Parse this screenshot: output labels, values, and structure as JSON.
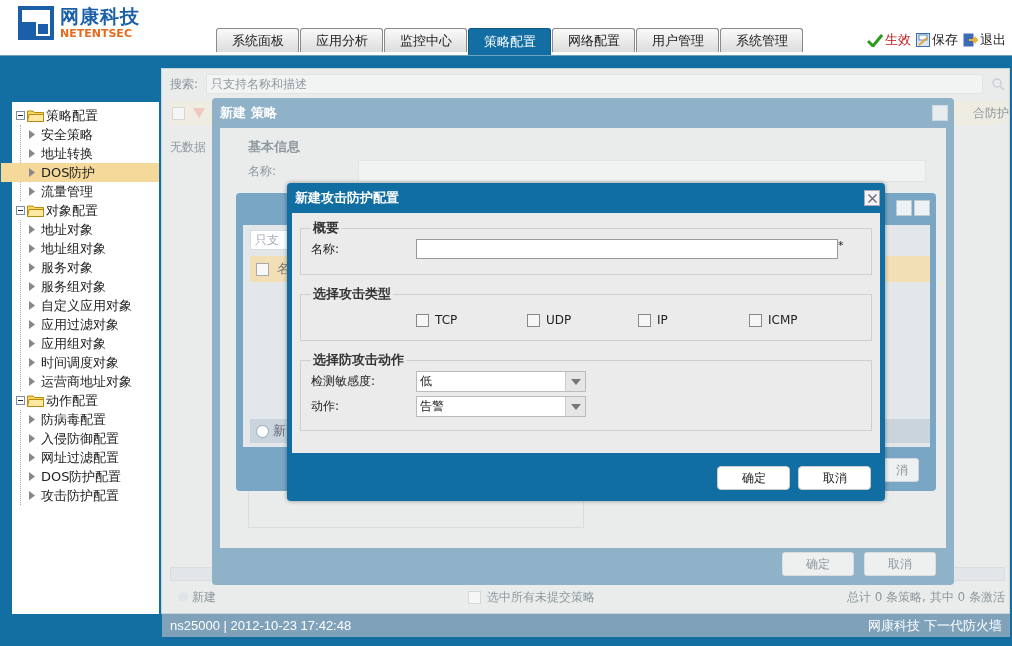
{
  "logo": {
    "name": "网康科技",
    "sub": "NETENTSEC"
  },
  "tabs": [
    {
      "label": "系统面板",
      "selected": false
    },
    {
      "label": "应用分析",
      "selected": false
    },
    {
      "label": "监控中心",
      "selected": false
    },
    {
      "label": "策略配置",
      "selected": true
    },
    {
      "label": "网络配置",
      "selected": false
    },
    {
      "label": "用户管理",
      "selected": false
    },
    {
      "label": "系统管理",
      "selected": false
    }
  ],
  "header_actions": [
    {
      "label": "生效",
      "kind": "apply"
    },
    {
      "label": "保存",
      "kind": "save"
    },
    {
      "label": "退出",
      "kind": "exit"
    }
  ],
  "sidebar": {
    "items": [
      {
        "label": "策略配置",
        "expanded": true,
        "children": [
          {
            "label": "安全策略",
            "selected": false
          },
          {
            "label": "地址转换",
            "selected": false
          },
          {
            "label": "DOS防护",
            "selected": true
          },
          {
            "label": "流量管理",
            "selected": false
          }
        ]
      },
      {
        "label": "对象配置",
        "expanded": true,
        "children": [
          {
            "label": "地址对象",
            "selected": false
          },
          {
            "label": "地址组对象",
            "selected": false
          },
          {
            "label": "服务对象",
            "selected": false
          },
          {
            "label": "服务组对象",
            "selected": false
          },
          {
            "label": "自定义应用对象",
            "selected": false
          },
          {
            "label": "应用过滤对象",
            "selected": false
          },
          {
            "label": "应用组对象",
            "selected": false
          },
          {
            "label": "时间调度对象",
            "selected": false
          },
          {
            "label": "运营商地址对象",
            "selected": false
          }
        ]
      },
      {
        "label": "动作配置",
        "expanded": true,
        "children": [
          {
            "label": "防病毒配置",
            "selected": false
          },
          {
            "label": "入侵防御配置",
            "selected": false
          },
          {
            "label": "网址过滤配置",
            "selected": false
          },
          {
            "label": "DOS防护配置",
            "selected": false
          },
          {
            "label": "攻击防护配置",
            "selected": false
          }
        ]
      }
    ]
  },
  "background_page": {
    "search_label": "搜索:",
    "search_placeholder": "只支持名称和描述",
    "column_cut": "合防护",
    "header_checked": false,
    "empty_text": "无数据",
    "toolbar_new": "新建",
    "select_all_label": "选中所有未提交策略",
    "select_all_checked": false,
    "summary": "总计 0 条策略, 其中 0 条激活"
  },
  "policy_dialog": {
    "title": "新建 策略",
    "section": "基本信息",
    "name_label": "名称:",
    "buttons": [
      "确定",
      "取消"
    ]
  },
  "middle_dialog": {
    "search_placeholder": "只支",
    "column": "名",
    "header_checked": false,
    "add_button": "新",
    "cancel_cut": "消"
  },
  "dialog": {
    "title": "新建攻击防护配置",
    "name_section": {
      "legend": "概要",
      "label": "名称:",
      "required": "*"
    },
    "type_section": {
      "legend": "选择攻击类型",
      "options": [
        {
          "label": "TCP",
          "checked": false
        },
        {
          "label": "UDP",
          "checked": false
        },
        {
          "label": "IP",
          "checked": false
        },
        {
          "label": "ICMP",
          "checked": false
        }
      ]
    },
    "action_section": {
      "legend": "选择防攻击动作",
      "selects": [
        {
          "label": "检测敏感度:",
          "value": "低"
        },
        {
          "label": "动作:",
          "value": "告警"
        }
      ]
    },
    "buttons": [
      "确定",
      "取消"
    ]
  },
  "status_bar": {
    "left": "ns25000 | 2012-10-23 17:42:48",
    "right": "网康科技 下一代防火墙"
  }
}
